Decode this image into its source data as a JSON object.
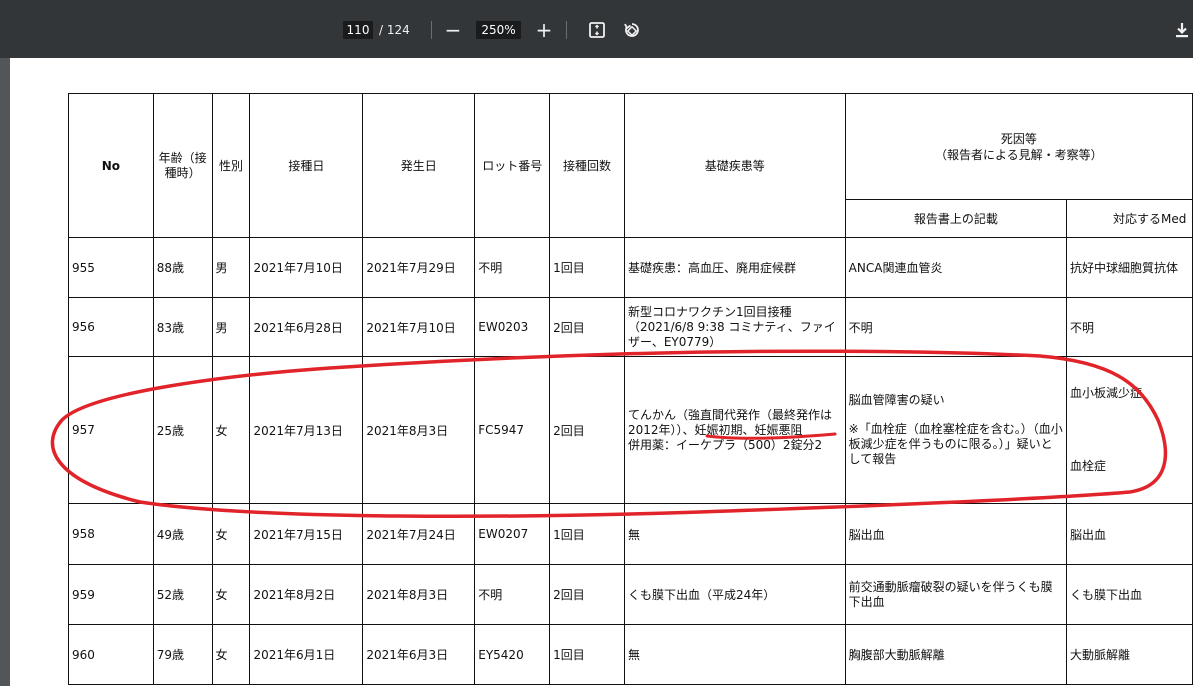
{
  "viewer": {
    "current_page": "110",
    "total_pages": "/ 124",
    "zoom": "250%",
    "zoom_out": "−",
    "zoom_in": "+",
    "icons": [
      "fit-page-icon",
      "rotate-icon",
      "download-icon"
    ]
  },
  "table": {
    "headers": {
      "no": "No",
      "age": "年齢（接種時）",
      "sex": "性別",
      "vaccination_date": "接種日",
      "onset_date": "発生日",
      "lot": "ロット番号",
      "dose": "接種回数",
      "underlying": "基礎疾患等",
      "cause_group": "死因等",
      "cause_group_sub": "（報告者による見解・考察等）",
      "report_entry": "報告書上の記載",
      "meddra": "対応するMed"
    },
    "rows": [
      {
        "no": "955",
        "age": "88歳",
        "sex": "男",
        "vaccination_date": "2021年7月10日",
        "onset_date": "2021年7月29日",
        "lot": "不明",
        "dose": "1回目",
        "underlying": "基礎疾患：高血圧、廃用症候群",
        "report": "ANCA関連血管炎",
        "meddra": "抗好中球細胞質抗体"
      },
      {
        "no": "956",
        "age": "83歳",
        "sex": "男",
        "vaccination_date": "2021年6月28日",
        "onset_date": "2021年7月10日",
        "lot": "EW0203",
        "dose": "2回目",
        "underlying": "新型コロナワクチン1回目接種（2021/6/8 9:38 コミナティ、ファイザー、EY0779）",
        "report": "不明",
        "meddra": "不明"
      },
      {
        "no": "957",
        "age": "25歳",
        "sex": "女",
        "vaccination_date": "2021年7月13日",
        "onset_date": "2021年8月3日",
        "lot": "FC5947",
        "dose": "2回目",
        "underlying": "てんかん（強直間代発作（最終発作は2012年））、妊娠初期、妊娠悪阻\n併用薬：イーケプラ（500）2錠分2",
        "report_lines": [
          "脳血管障害の疑い",
          "※「血栓症（血栓塞栓症を含む。）（血小板減少症を伴うものに限る。）」疑いとして報告"
        ],
        "meddra_lines": [
          "血小板減少症",
          "血栓症"
        ]
      },
      {
        "no": "958",
        "age": "49歳",
        "sex": "女",
        "vaccination_date": "2021年7月15日",
        "onset_date": "2021年7月24日",
        "lot": "EW0207",
        "dose": "1回目",
        "underlying": "無",
        "report": "脳出血",
        "meddra": "脳出血"
      },
      {
        "no": "959",
        "age": "52歳",
        "sex": "女",
        "vaccination_date": "2021年8月2日",
        "onset_date": "2021年8月3日",
        "lot": "不明",
        "dose": "2回目",
        "underlying": "くも膜下出血（平成24年）",
        "report": "前交通動脈瘤破裂の疑いを伴うくも膜下出血",
        "meddra": "くも膜下出血"
      },
      {
        "no": "960",
        "age": "79歳",
        "sex": "女",
        "vaccination_date": "2021年6月1日",
        "onset_date": "2021年6月3日",
        "lot": "EY5420",
        "dose": "1回目",
        "underlying": "無",
        "report": "胸腹部大動脈解離",
        "meddra": "大動脈解離"
      }
    ]
  },
  "annotation": {
    "marker_color": "#e0242a"
  }
}
